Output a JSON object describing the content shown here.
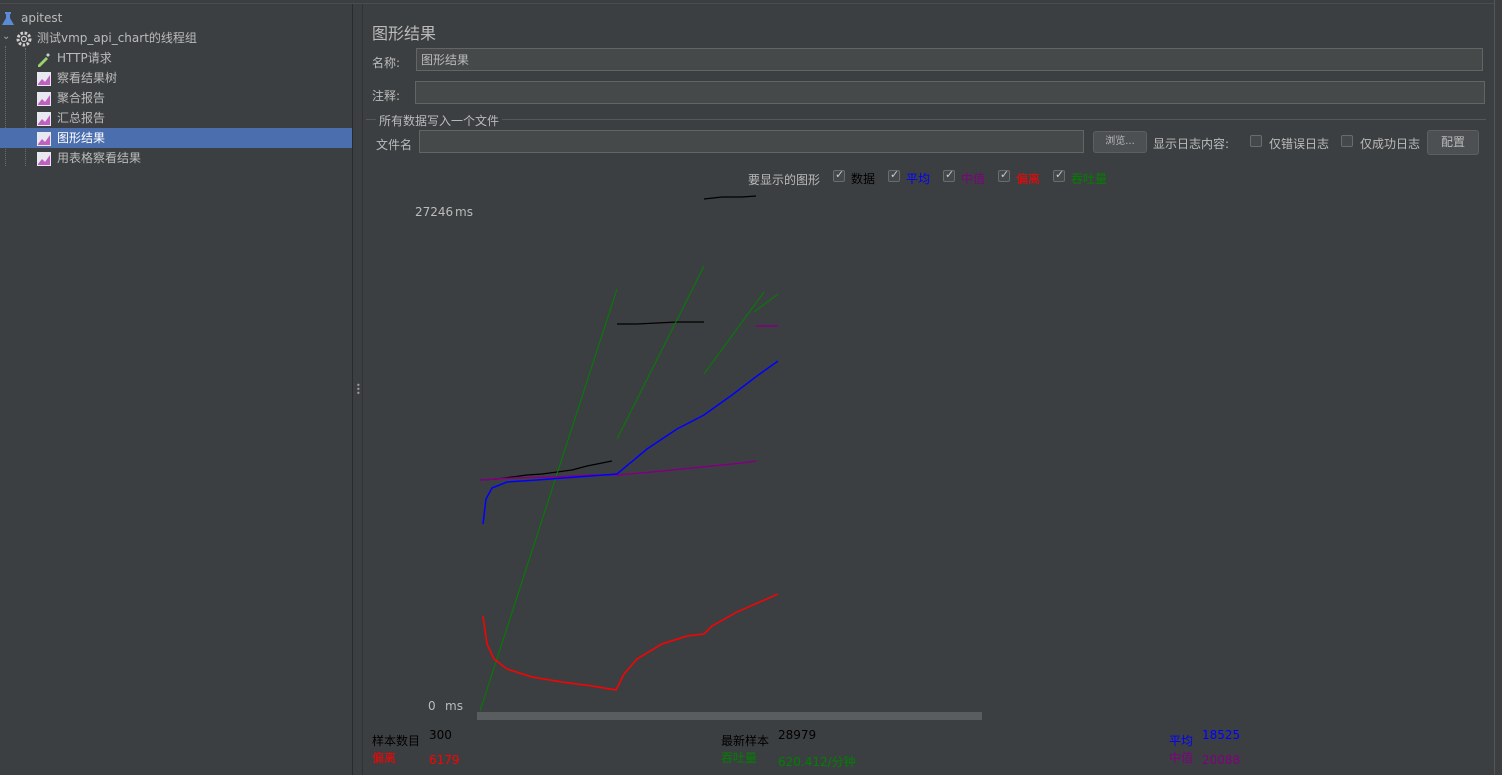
{
  "tree": {
    "root": "apitest",
    "group": "测试vmp_api_chart的线程组",
    "items": [
      "HTTP请求",
      "察看结果树",
      "聚合报告",
      "汇总报告",
      "图形结果",
      "用表格察看结果"
    ]
  },
  "panel": {
    "title": "图形结果",
    "name_label": "名称:",
    "name_value": "图形结果",
    "comment_label": "注释:",
    "comment_value": "",
    "section_title": "所有数据写入一个文件",
    "filename_label": "文件名",
    "filename_value": "",
    "browse_button": "浏览...",
    "log_label": "显示日志内容:",
    "errors_only": "仅错误日志",
    "success_only": "仅成功日志",
    "config_button": "配置"
  },
  "graph": {
    "legend_title": "要显示的图形",
    "legend": [
      {
        "label": "数据",
        "color": "#000000",
        "checked": true
      },
      {
        "label": "平均",
        "color": "#0000ff",
        "checked": true
      },
      {
        "label": "中值",
        "color": "#800080",
        "checked": true
      },
      {
        "label": "偏离",
        "color": "#ff0000",
        "checked": true
      },
      {
        "label": "吞吐量",
        "color": "#008000",
        "checked": true
      }
    ],
    "y_max": "27246",
    "y_min": "0",
    "y_unit": "ms"
  },
  "stats": {
    "samples_label": "样本数目",
    "samples_value": "300",
    "deviation_label": "偏离",
    "deviation_value": "6179",
    "latest_label": "最新样本",
    "latest_value": "28979",
    "throughput_label": "吞吐量",
    "throughput_value": "620.412/分钟",
    "average_label": "平均",
    "average_value": "18525",
    "median_label": "中值",
    "median_value": "20088"
  },
  "colors": {
    "data": "#000000",
    "average": "#0000ff",
    "median": "#800080",
    "deviation": "#ff0000",
    "throughput": "#008000",
    "selection": "#4b6eaf"
  }
}
